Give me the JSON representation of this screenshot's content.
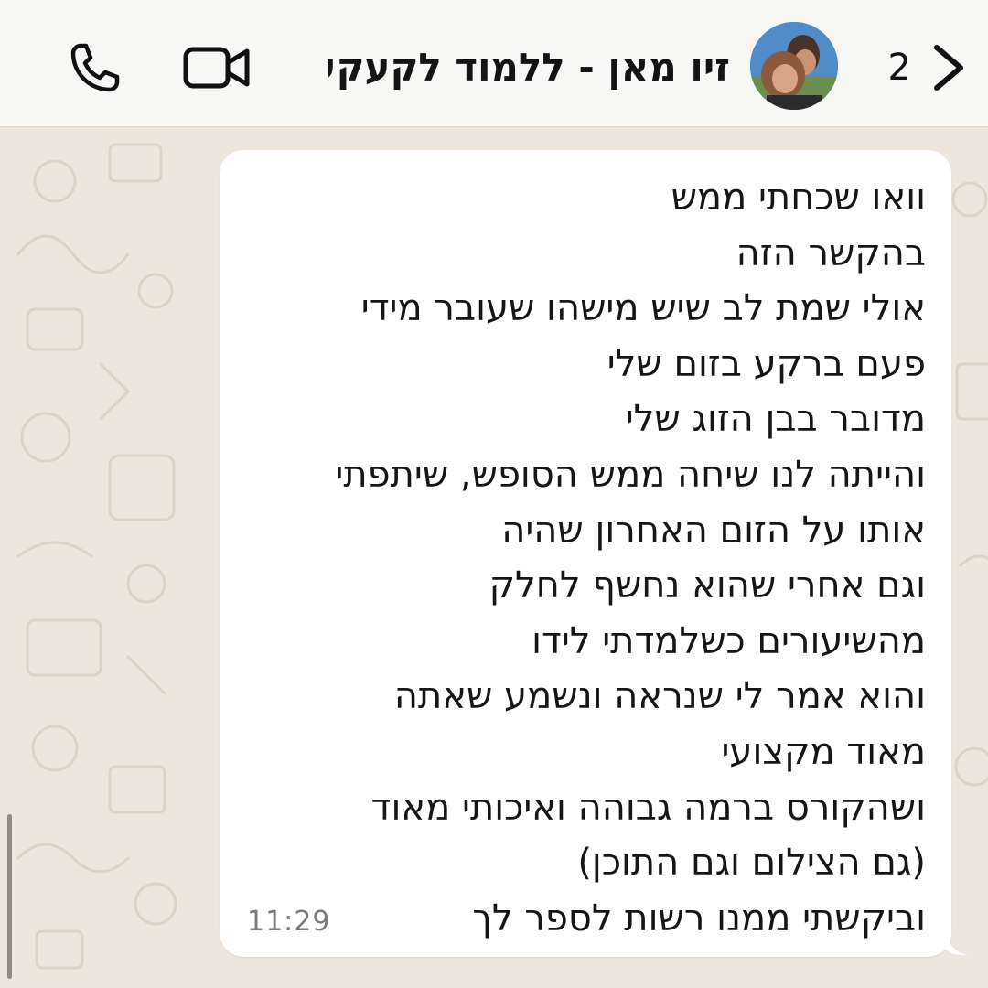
{
  "header": {
    "unread_count": "2",
    "contact_name": "זיו מאן - ללמוד לקעקע...",
    "back_icon": "chevron-right-icon",
    "video_icon": "video-camera-icon",
    "phone_icon": "phone-icon"
  },
  "message": {
    "lines": [
      "וואו שכחתי ממש",
      "בהקשר הזה",
      "אולי שמת לב שיש מישהו שעובר מידי",
      "פעם ברקע בזום שלי",
      "מדובר בבן הזוג שלי",
      "והייתה לנו שיחה ממש הסופש, שיתפתי",
      "אותו על הזום האחרון שהיה",
      "וגם אחרי שהוא נחשף לחלק",
      "מהשיעורים כשלמדתי לידו",
      "והוא אמר לי שנראה ונשמע שאתה",
      "מאוד מקצועי",
      "ושהקורס ברמה גבוהה ואיכותי מאוד",
      "(גם הצילום וגם התוכן)",
      "וביקשתי ממנו רשות לספר לך"
    ],
    "time": "11:29"
  },
  "colors": {
    "header_bg": "#f7f7f5",
    "wallpaper_bg": "#ede6dc",
    "bubble_bg": "#ffffff",
    "text": "#161616",
    "timestamp": "#7a7a7a"
  }
}
